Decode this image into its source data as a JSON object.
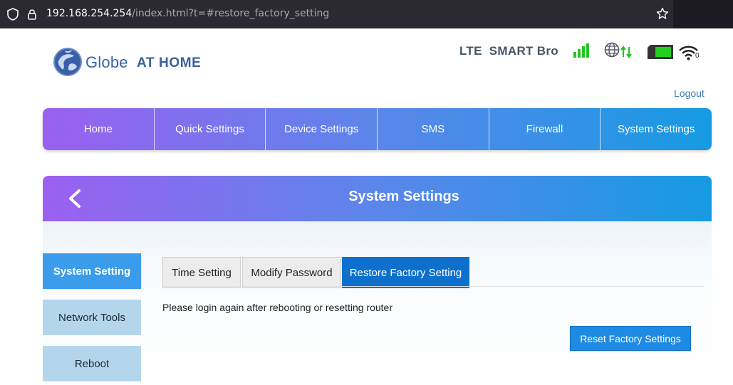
{
  "browser": {
    "url_host": "192.168.254.254",
    "url_path": "/index.html?t=#restore_factory_setting"
  },
  "header": {
    "brand_globe": "Globe",
    "brand_home": "AT HOME",
    "network": "LTE  SMART Bro",
    "wifi_count": "0",
    "logout": "Logout"
  },
  "nav": {
    "items": [
      "Home",
      "Quick Settings",
      "Device Settings",
      "SMS",
      "Firewall",
      "System Settings"
    ]
  },
  "panel": {
    "title": "System Settings"
  },
  "sidebar": {
    "items": [
      "System Setting",
      "Network Tools",
      "Reboot"
    ]
  },
  "tabs": {
    "items": [
      "Time Setting",
      "Modify Password",
      "Restore Factory Setting"
    ]
  },
  "content": {
    "note": "Please login again after rebooting or resetting router",
    "reset_button": "Reset Factory Settings"
  },
  "colors": {
    "nav_gradient_start": "#9b60f0",
    "nav_gradient_end": "#169be2",
    "active_tab": "#0c70cc",
    "active_side": "#3a9cea",
    "signal_green": "#22c422"
  }
}
